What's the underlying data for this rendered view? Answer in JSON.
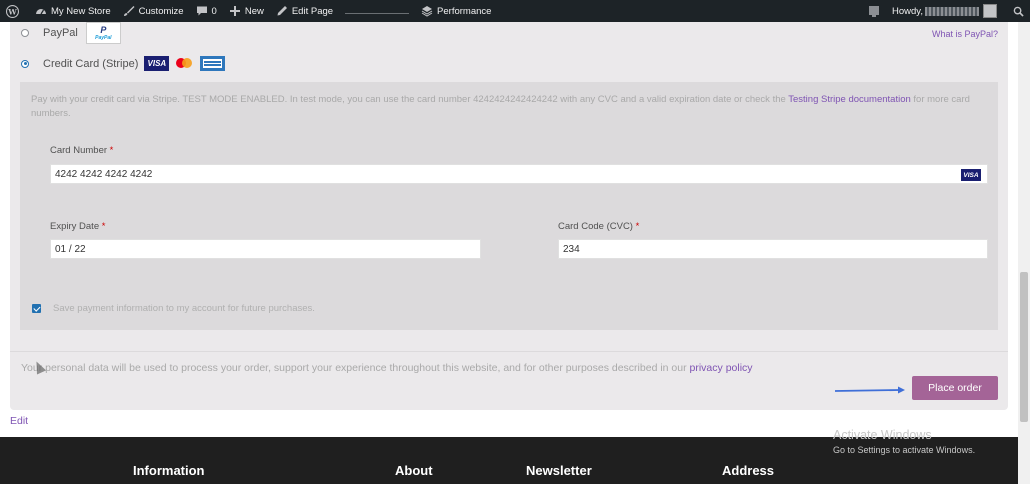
{
  "admin_bar": {
    "site_name": "My New Store",
    "customize": "Customize",
    "comments_count": "0",
    "new": "New",
    "edit_page": "Edit Page",
    "performance": "Performance",
    "howdy": "Howdy,"
  },
  "payment": {
    "paypal_label": "PayPal",
    "paypal_logo_text": "PayPal",
    "what_is_paypal": "What is PayPal?",
    "credit_card_label": "Credit Card (Stripe)",
    "visa_logo_text": "VISA",
    "stripe_description": "Pay with your credit card via Stripe. TEST MODE ENABLED. In test mode, you can use the card number 4242424242424242 with any CVC and a valid expiration date or check the",
    "stripe_doc_link": "Testing Stripe documentation",
    "stripe_description_end": "for more card numbers.",
    "card_number_label": "Card Number",
    "card_number_value": "4242 4242 4242 4242",
    "expiry_label": "Expiry Date",
    "expiry_value": "01 / 22",
    "cvc_label": "Card Code (CVC)",
    "cvc_value": "234",
    "required_mark": "*",
    "save_info_label": "Save payment information to my account for future purchases."
  },
  "privacy": {
    "text": "Your personal data will be used to process your order, support your experience throughout this website, and for other purposes described in our",
    "link": "privacy policy"
  },
  "place_order_label": "Place order",
  "edit_label": "Edit",
  "footer": {
    "headings": [
      "Information",
      "About",
      "Newsletter",
      "Address"
    ]
  },
  "windows_watermark": {
    "title": "Activate Windows",
    "subtitle": "Go to Settings to activate Windows."
  },
  "colors": {
    "accent": "#7f54b3",
    "button": "#a46497",
    "admin_bar": "#1d2327",
    "footer": "#1f1f1f"
  }
}
